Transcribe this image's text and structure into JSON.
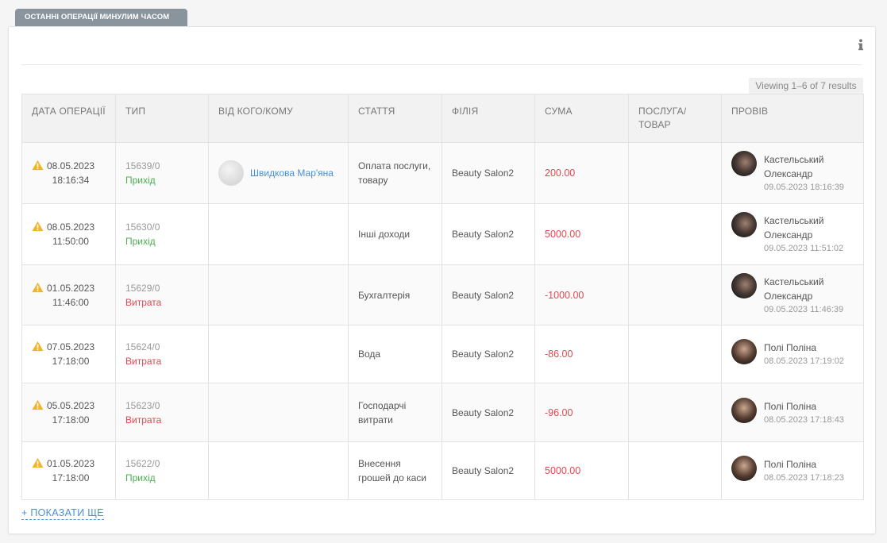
{
  "tab_title": "ОСТАННІ ОПЕРАЦІЇ МИНУЛИМ ЧАСОМ",
  "results_text": "Viewing 1–6 of 7 results",
  "columns": [
    "ДАТА ОПЕРАЦІЇ",
    "ТИП",
    "ВІД КОГО/КОМУ",
    "СТАТТЯ",
    "ФІЛІЯ",
    "СУМА",
    "ПОСЛУГА/ ТОВАР",
    "ПРОВІВ"
  ],
  "rows": [
    {
      "date": "08.05.2023",
      "time": "18:16:34",
      "op_number": "15639/0",
      "type": "Прихід",
      "type_kind": "in",
      "counterparty": "Швидкова Мар'яна",
      "article": "Оплата послуги, товару",
      "branch": "Beauty Salon2",
      "amount": "200.00",
      "service": "",
      "staff_name": "Кастельський Олександр",
      "staff_time": "09.05.2023 18:16:39",
      "staff_avatar": "a"
    },
    {
      "date": "08.05.2023",
      "time": "11:50:00",
      "op_number": "15630/0",
      "type": "Прихід",
      "type_kind": "in",
      "counterparty": "",
      "article": "Інші доходи",
      "branch": "Beauty Salon2",
      "amount": "5000.00",
      "service": "",
      "staff_name": "Кастельський Олександр",
      "staff_time": "09.05.2023 11:51:02",
      "staff_avatar": "a"
    },
    {
      "date": "01.05.2023",
      "time": "11:46:00",
      "op_number": "15629/0",
      "type": "Витрата",
      "type_kind": "out",
      "counterparty": "",
      "article": "Бухгалтерія",
      "branch": "Beauty Salon2",
      "amount": "-1000.00",
      "service": "",
      "staff_name": "Кастельський Олександр",
      "staff_time": "09.05.2023 11:46:39",
      "staff_avatar": "a"
    },
    {
      "date": "07.05.2023",
      "time": "17:18:00",
      "op_number": "15624/0",
      "type": "Витрата",
      "type_kind": "out",
      "counterparty": "",
      "article": "Вода",
      "branch": "Beauty Salon2",
      "amount": "-86.00",
      "service": "",
      "staff_name": "Полі Поліна",
      "staff_time": "08.05.2023 17:19:02",
      "staff_avatar": "b"
    },
    {
      "date": "05.05.2023",
      "time": "17:18:00",
      "op_number": "15623/0",
      "type": "Витрата",
      "type_kind": "out",
      "counterparty": "",
      "article": "Господарчі витрати",
      "branch": "Beauty Salon2",
      "amount": "-96.00",
      "service": "",
      "staff_name": "Полі Поліна",
      "staff_time": "08.05.2023 17:18:43",
      "staff_avatar": "b"
    },
    {
      "date": "01.05.2023",
      "time": "17:18:00",
      "op_number": "15622/0",
      "type": "Прихід",
      "type_kind": "in",
      "counterparty": "",
      "article": "Внесення грошей до каси",
      "branch": "Beauty Salon2",
      "amount": "5000.00",
      "service": "",
      "staff_name": "Полі Поліна",
      "staff_time": "08.05.2023 17:18:23",
      "staff_avatar": "b"
    }
  ],
  "show_more": "+ ПОКАЗАТИ ЩЕ",
  "colors": {
    "income": "#4cb050",
    "expense": "#e2474d",
    "link": "#4a8fd3",
    "warning": "#f0b429",
    "tab": "#8a949c"
  },
  "icons": {
    "info": "info-icon",
    "warning": "warning-icon"
  }
}
